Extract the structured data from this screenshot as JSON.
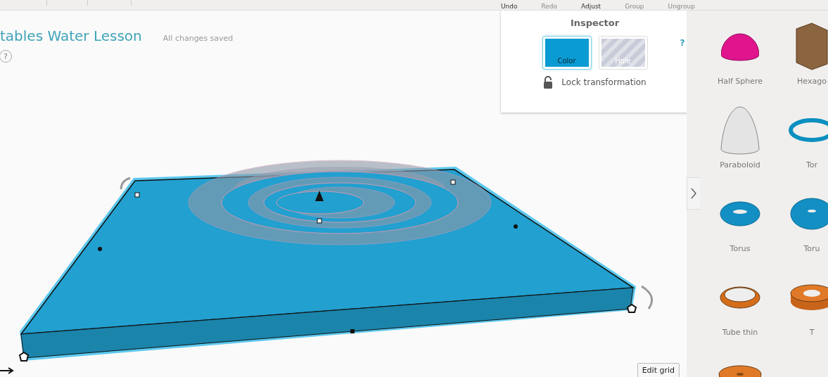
{
  "toolbar": {
    "items": [
      {
        "label": "Undo",
        "disabled": false
      },
      {
        "label": "Redo",
        "disabled": true
      },
      {
        "label": "Adjust",
        "disabled": false
      },
      {
        "label": "Group",
        "disabled": true
      },
      {
        "label": "Ungroup",
        "disabled": true
      }
    ]
  },
  "design": {
    "title": "tables Water Lesson",
    "save_status": "All changes saved",
    "help": "?"
  },
  "inspector": {
    "title": "Inspector",
    "help": "?",
    "modes": [
      {
        "label": "Color",
        "kind": "color",
        "selected": true
      },
      {
        "label": "Hole",
        "kind": "hole",
        "selected": false
      }
    ],
    "lock": {
      "label": "Lock transformation",
      "locked": false
    }
  },
  "edit_grid": {
    "label": "Edit grid"
  },
  "panel_toggle": {
    "expanded": true
  },
  "shapes": [
    {
      "label": "Half Sphere",
      "kind": "half-sphere"
    },
    {
      "label": "Hexago",
      "kind": "hexagonal-prism"
    },
    {
      "label": "Paraboloid",
      "kind": "paraboloid"
    },
    {
      "label": "Tor",
      "kind": "torus-thin"
    },
    {
      "label": "Torus",
      "kind": "torus"
    },
    {
      "label": "Toru",
      "kind": "torus-thick"
    },
    {
      "label": "Tube thin",
      "kind": "tube-thin"
    },
    {
      "label": "T",
      "kind": "tube"
    },
    {
      "kind": "cylinder-hole"
    }
  ]
}
